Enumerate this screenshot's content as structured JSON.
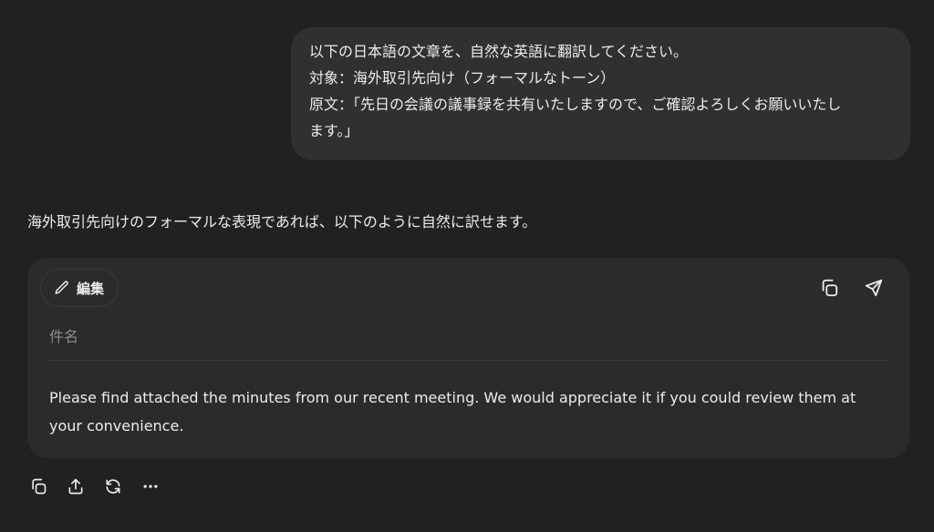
{
  "user_message": {
    "lines": [
      "以下の日本語の文章を、自然な英語に翻訳してください。",
      "対象：海外取引先向け（フォーマルなトーン）",
      "原文：「先日の会議の議事録を共有いたしますので、ご確認よろしくお願いいたし",
      "ます。」"
    ]
  },
  "assistant": {
    "intro": "海外取引先向けのフォーマルな表現であれば、以下のように自然に訳せます。",
    "email_card": {
      "edit_label": "編集",
      "subject_placeholder": "件名",
      "body": "Please find attached the minutes from our recent meeting. We would appreciate it if you could review them at your convenience."
    }
  },
  "icons": {
    "edit": "pencil-icon",
    "copy": "copy-icon",
    "send": "send-icon",
    "share": "share-icon",
    "regenerate": "regenerate-icon",
    "more": "more-icon"
  },
  "colors": {
    "background": "#212121",
    "user_bubble": "#303030",
    "card": "#2b2b2b",
    "text": "#ececec",
    "muted_text": "#8e8e8e"
  }
}
